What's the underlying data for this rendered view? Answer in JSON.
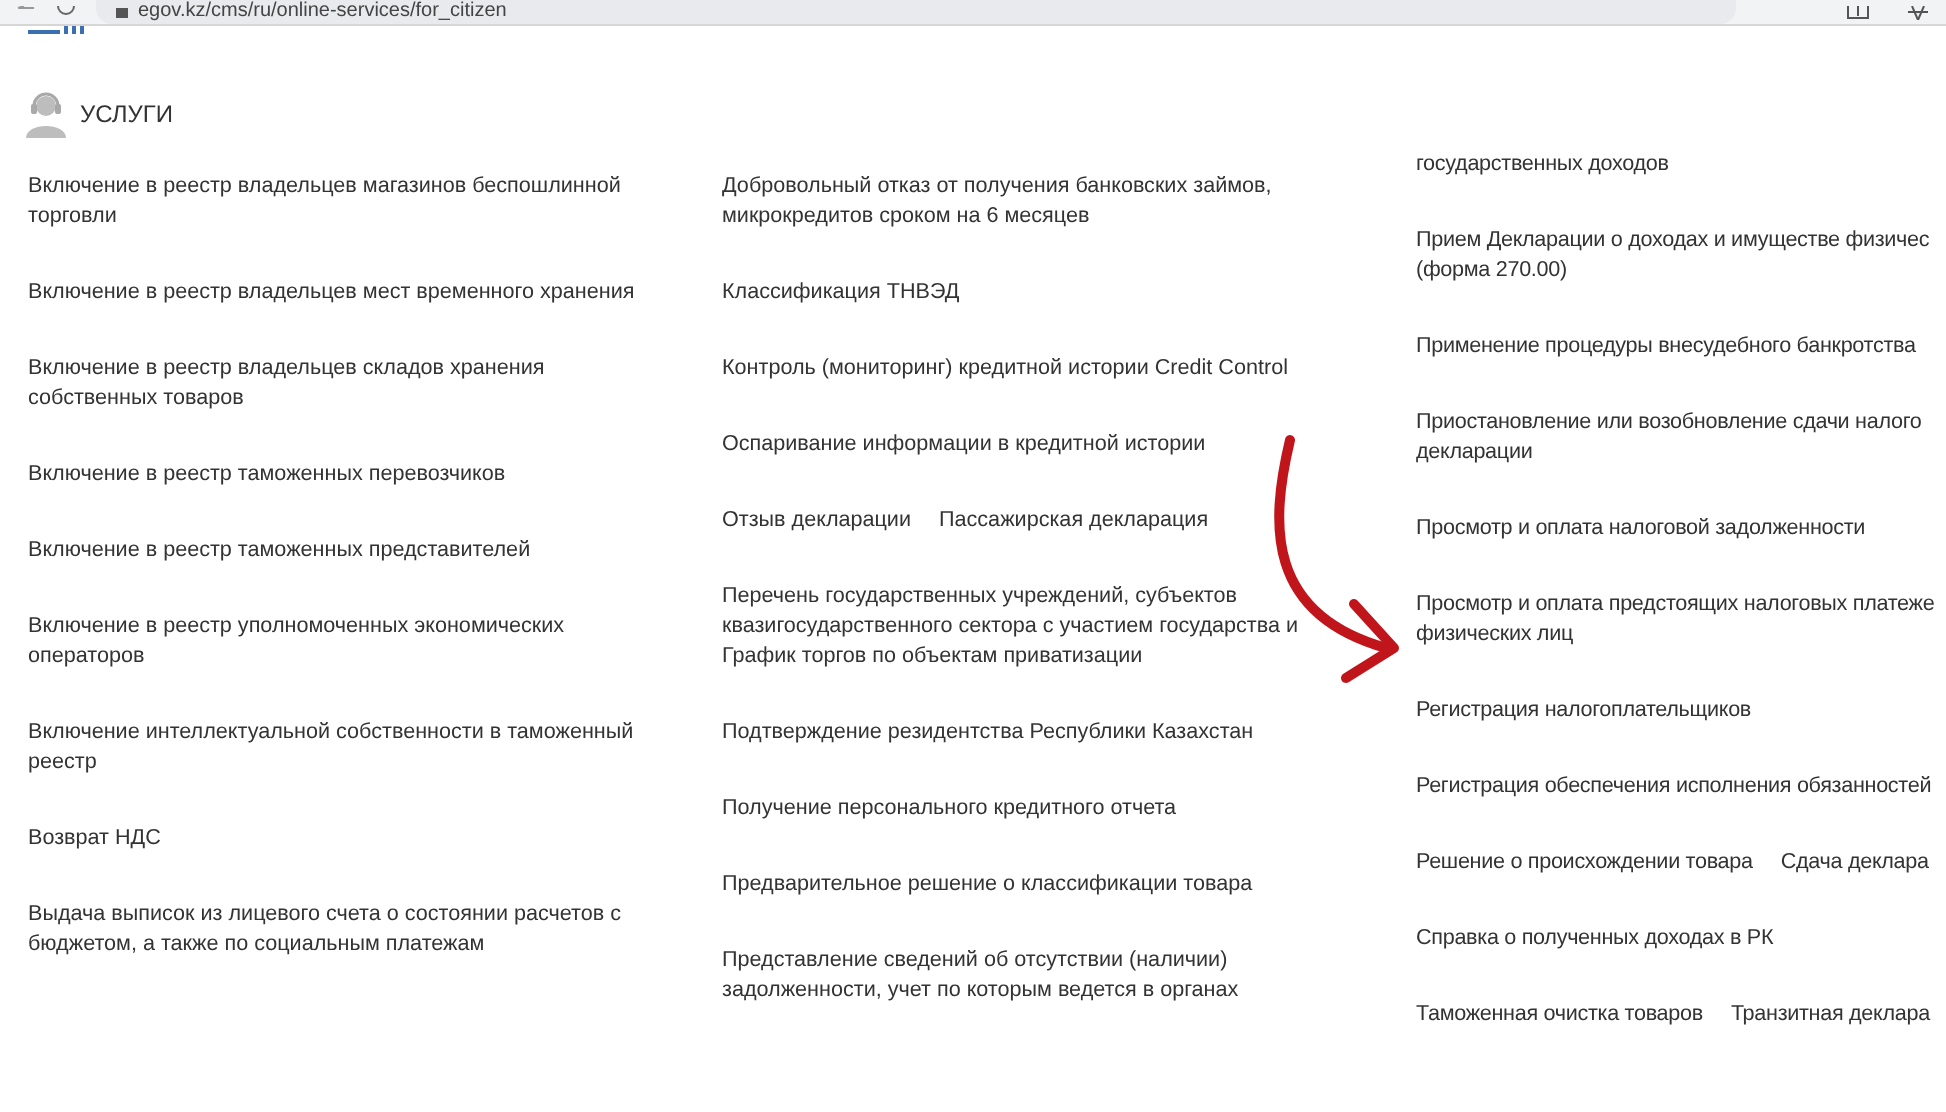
{
  "browser": {
    "url": "egov.kz/cms/ru/online-services/for_citizen"
  },
  "section": {
    "title": "УСЛУГИ"
  },
  "columns": [
    {
      "rows": [
        {
          "links": [
            "Включение в реестр владельцев магазинов беспошлинной\nторговли"
          ]
        },
        {
          "links": [
            "Включение в реестр владельцев мест временного хранения"
          ]
        },
        {
          "links": [
            "Включение в реестр владельцев складов хранения\nсобственных товаров"
          ]
        },
        {
          "links": [
            "Включение в реестр таможенных перевозчиков"
          ]
        },
        {
          "links": [
            "Включение в реестр таможенных представителей"
          ]
        },
        {
          "links": [
            "Включение в реестр уполномоченных экономических\nоператоров"
          ]
        },
        {
          "links": [
            "Включение интеллектуальной собственности в таможенный\nреестр"
          ]
        },
        {
          "links": [
            "Возврат НДС"
          ]
        },
        {
          "links": [
            "Выдача выписок из лицевого счета о состоянии расчетов с\nбюджетом, а также по социальным платежам"
          ]
        }
      ]
    },
    {
      "rows": [
        {
          "links": [
            "Добровольный отказ от получения банковских займов,\nмикрокредитов сроком на 6 месяцев"
          ]
        },
        {
          "links": [
            "Классификация ТНВЭД"
          ]
        },
        {
          "links": [
            "Контроль (мониторинг) кредитной истории Credit Control"
          ]
        },
        {
          "links": [
            "Оспаривание информации в кредитной истории"
          ]
        },
        {
          "links": [
            "Отзыв декларации",
            "Пассажирская декларация"
          ]
        },
        {
          "links": [
            "Перечень государственных учреждений, субъектов\nквазигосударственного сектора с участием государства и\nГрафик торгов по объектам приватизации"
          ]
        },
        {
          "links": [
            "Подтверждение резидентства Республики Казахстан"
          ]
        },
        {
          "links": [
            "Получение персонального кредитного отчета"
          ]
        },
        {
          "links": [
            "Предварительное решение о классификации товара"
          ]
        },
        {
          "links": [
            "Представление сведений об отсутствии (наличии)\nзадолженности, учет по которым ведется в органах"
          ]
        }
      ]
    },
    {
      "rows": [
        {
          "links": [
            "государственных доходов"
          ]
        },
        {
          "links": [
            "Прием Декларации о доходах и имуществе физичес\n(форма 270.00)"
          ]
        },
        {
          "links": [
            "Применение процедуры внесудебного банкротства"
          ]
        },
        {
          "links": [
            "Приостановление или возобновление сдачи налого\nдекларации"
          ]
        },
        {
          "links": [
            "Просмотр и оплата налоговой задолженности"
          ]
        },
        {
          "links": [
            "Просмотр и оплата предстоящих налоговых платеже\nфизических лиц"
          ]
        },
        {
          "links": [
            "Регистрация налогоплательщиков"
          ]
        },
        {
          "links": [
            "Регистрация обеспечения исполнения обязанностей"
          ]
        },
        {
          "links": [
            "Решение о происхождении товара",
            "Сдача деклара"
          ]
        },
        {
          "links": [
            "Справка о полученных доходах в РК"
          ]
        },
        {
          "links": [
            "Таможенная очистка товаров",
            "Транзитная деклара"
          ]
        }
      ]
    }
  ]
}
